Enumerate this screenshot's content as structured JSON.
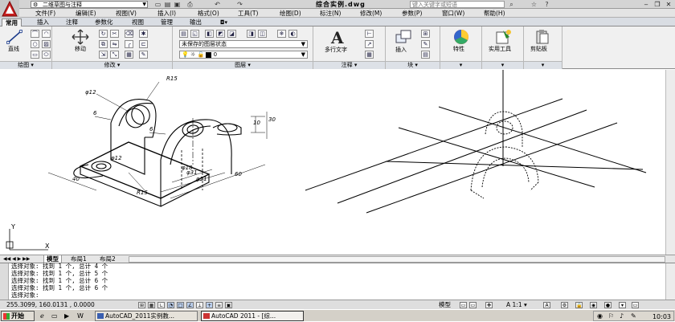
{
  "title_bar": {
    "workspace": "二维草图与注释",
    "document_title": "综合实例.dwg",
    "search_placeholder": "键入关键字或短语",
    "quick_access": [
      "new-icon",
      "open-icon",
      "save-icon",
      "print-icon",
      "undo-icon",
      "redo-icon"
    ],
    "window_buttons": [
      "minimize-icon",
      "restore-icon",
      "close-icon"
    ]
  },
  "menu_bar": {
    "items": [
      "文件(F)",
      "编辑(E)",
      "视图(V)",
      "插入(I)",
      "格式(O)",
      "工具(T)",
      "绘图(D)",
      "标注(N)",
      "修改(M)",
      "参数(P)",
      "窗口(W)",
      "帮助(H)"
    ]
  },
  "ribbon_tabs": {
    "items": [
      "常用",
      "插入",
      "注释",
      "参数化",
      "视图",
      "管理",
      "输出"
    ],
    "active": "常用"
  },
  "ribbon": {
    "draw": {
      "footer": "绘图",
      "big_button": "直线"
    },
    "modify": {
      "footer": "修改",
      "big_button": "移动"
    },
    "layers": {
      "footer": "图层",
      "layer_state": "未保存的图层状态",
      "current_layer": "0"
    },
    "annotation": {
      "footer": "注释",
      "big_button": "多行文字",
      "big_icon": "A"
    },
    "block": {
      "footer": "块",
      "big_button": "插入"
    },
    "properties": {
      "big_button": "特性"
    },
    "utilities": {
      "big_button": "实用工具"
    },
    "clipboard": {
      "big_button": "剪贴板"
    }
  },
  "drawing": {
    "dims": {
      "r15_top": "R15",
      "phi12": "φ12",
      "six_left": "6",
      "six_mid": "6",
      "phi18": "φ18",
      "phi31": "φ31",
      "phi51": "φ51",
      "v_10": "10",
      "v_30": "30",
      "len_60": "60",
      "w_40": "40",
      "r15_bottom": "R15",
      "phi12_bottom": "φ12"
    },
    "ucs": {
      "x": "X",
      "y": "Y"
    }
  },
  "layout_tabs": {
    "items": [
      "模型",
      "布局1",
      "布局2"
    ],
    "active": "模型"
  },
  "command_window": {
    "lines": [
      "选择对象: 找到 1 个, 总计 4 个",
      "选择对象: 找到 1 个, 总计 5 个",
      "选择对象: 找到 1 个, 总计 6 个",
      "选择对象: 找到 1 个, 总计 6 个",
      "选择对象:"
    ]
  },
  "status_bar": {
    "coordinates": "255.3099, 160.0131 , 0.0000",
    "model_label": "模型",
    "scale": "1:1",
    "toggles": [
      {
        "name": "snap",
        "on": false
      },
      {
        "name": "grid",
        "on": false
      },
      {
        "name": "ortho",
        "on": false
      },
      {
        "name": "polar",
        "on": true
      },
      {
        "name": "osnap",
        "on": true
      },
      {
        "name": "otrack",
        "on": true
      },
      {
        "name": "ducs",
        "on": false
      },
      {
        "name": "dyn",
        "on": true
      },
      {
        "name": "lwt",
        "on": false
      },
      {
        "name": "qp",
        "on": false
      }
    ]
  },
  "taskbar": {
    "start": "开始",
    "tasks": [
      "AutoCAD_2011实例教...",
      "AutoCAD 2011 - [综..."
    ],
    "active_task": 1,
    "clock": "10:03"
  }
}
